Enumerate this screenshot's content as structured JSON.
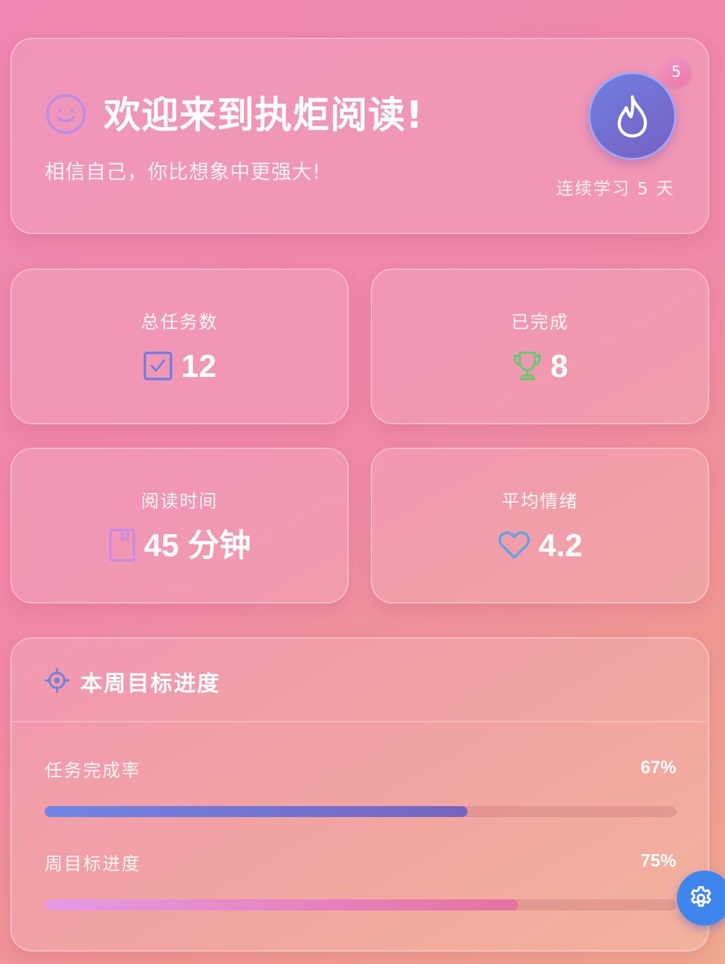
{
  "welcome": {
    "title": "欢迎来到执炬阅读!",
    "subtitle": "相信自己，你比想象中更强大!",
    "streak_count": "5",
    "streak_label": "连续学习 5 天",
    "icons": [
      "smile-icon",
      "fire-icon"
    ]
  },
  "stats": [
    {
      "label": "总任务数",
      "value": "12",
      "icon": "checkbox-icon",
      "icon_color": "#6b7fe0"
    },
    {
      "label": "已完成",
      "value": "8",
      "icon": "trophy-icon",
      "icon_color": "#6fc472"
    },
    {
      "label": "阅读时间",
      "value": "45 分钟",
      "icon": "book-icon",
      "icon_color": "#c48ce8"
    },
    {
      "label": "平均情绪",
      "value": "4.2",
      "icon": "heart-icon",
      "icon_color": "#5aa2e8"
    }
  ],
  "goals": {
    "title": "本周目标进度",
    "icon": "target-icon",
    "items": [
      {
        "name": "任务完成率",
        "percent_label": "67%",
        "progress": 67
      },
      {
        "name": "周目标进度",
        "percent_label": "75%",
        "progress": 75
      }
    ]
  },
  "settings_fab": {
    "icon": "gear-icon"
  },
  "colors": {
    "accent": "#6f7fe0",
    "fab": "#3f85ee",
    "streak_badge": "#ea7db0"
  }
}
